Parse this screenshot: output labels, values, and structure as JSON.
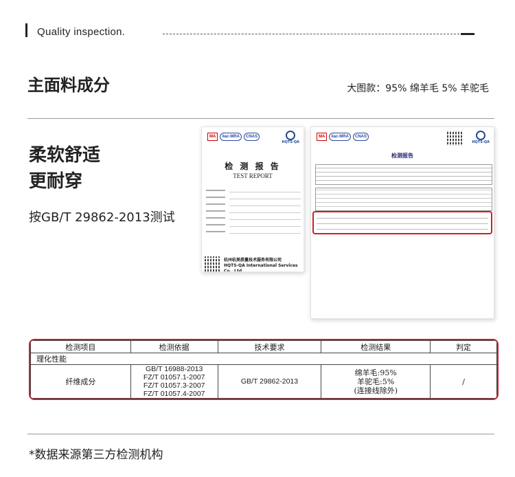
{
  "header": {
    "title": "Quality inspection."
  },
  "section": {
    "title": "主面料成分",
    "subtitle": "大图款：95% 绵羊毛  5% 羊驼毛"
  },
  "features": {
    "line1": "柔软舒适",
    "line2": "更耐穿"
  },
  "standard_text": "按GB/T 29862-2013测试",
  "report_cover": {
    "logos": [
      "MA",
      "ilac-MRA",
      "CNAS"
    ],
    "brand": "HQTS·QA",
    "title_cn": "检 测 报 告",
    "title_en": "TEST REPORT",
    "company_cn": "杭州杭美质量技术服务有限公司",
    "company_en": "HQTS-QA International Services Co., Ltd"
  },
  "report_page": {
    "title": "检测报告",
    "brand": "HQTS-QA"
  },
  "result_table": {
    "headers": [
      "检测项目",
      "检测依据",
      "技术要求",
      "检测结果",
      "判定"
    ],
    "category": "理化性能",
    "row": {
      "item": "纤维成分",
      "basis": [
        "GB/T 16988-2013",
        "FZ/T 01057.1-2007",
        "FZ/T 01057.3-2007",
        "FZ/T 01057.4-2007"
      ],
      "requirement": "GB/T 29862-2013",
      "result": [
        "绵羊毛:95%",
        "羊驼毛:5%",
        "(连接线除外)"
      ],
      "verdict": "/"
    }
  },
  "footnote": "*数据来源第三方检测机构",
  "colors": {
    "highlight_border": "#c8202a",
    "text": "#222222"
  }
}
